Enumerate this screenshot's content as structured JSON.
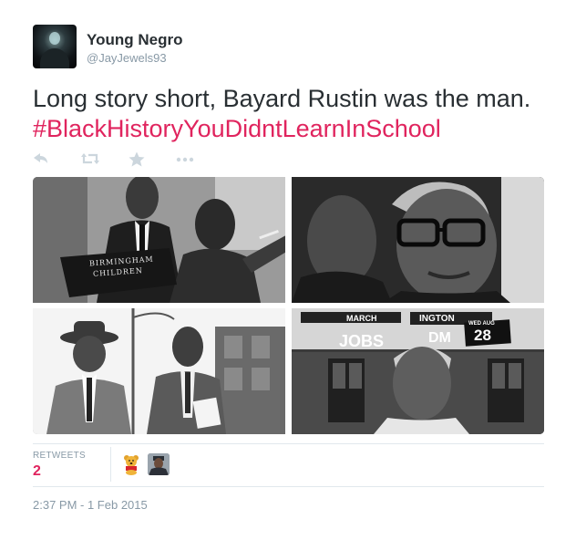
{
  "user": {
    "name": "Young Negro",
    "handle": "@JayJewels93"
  },
  "tweet": {
    "text": "Long story short, Bayard Rustin was the man.",
    "hashtag": "#BlackHistoryYouDidntLearnInSchool"
  },
  "actions": [
    {
      "icon": "reply-icon"
    },
    {
      "icon": "retweet-icon"
    },
    {
      "icon": "favorite-star-icon"
    },
    {
      "icon": "more-dots-icon"
    }
  ],
  "media": {
    "photo1_sign_line1": "BIRMINGHAM",
    "photo1_sign_line2": "CHILDREN",
    "photo4_banner_left": "JOBS",
    "photo4_banner_mid": "DM",
    "photo4_banner_top1": "MARCH",
    "photo4_banner_top2": "INGTON",
    "photo4_banner_date": "WED AUG",
    "photo4_banner_num": "28"
  },
  "stats": {
    "retweets_label": "RETWEETS",
    "retweets_count": "2"
  },
  "retweeters": [
    {
      "icon": "winnie-the-pooh-avatar-icon"
    },
    {
      "icon": "user-photo-avatar-icon"
    }
  ],
  "timestamp": "2:37 PM - 1 Feb 2015",
  "colors": {
    "hashtag": "#e0245e",
    "secondary_text": "#8899a6",
    "action_icon": "#ccd6dd",
    "divider": "#e1e8ed"
  }
}
